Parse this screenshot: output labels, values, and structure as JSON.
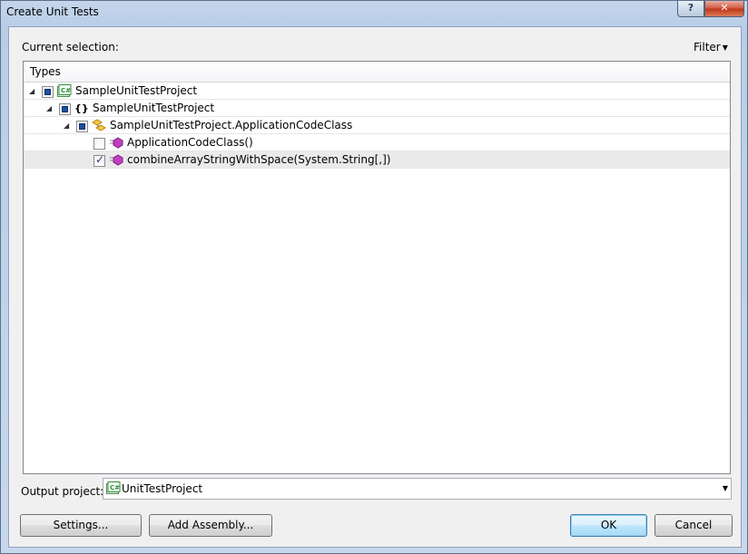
{
  "window": {
    "title": "Create Unit Tests",
    "help_label": "?",
    "close_label": "✕"
  },
  "current_selection_label": "Current selection:",
  "filter_label": "Filter",
  "tree": {
    "header": "Types",
    "rows": [
      {
        "label": "SampleUnitTestProject",
        "expander": "◢",
        "check": "partial",
        "icon": "csharp-project-icon"
      },
      {
        "label": "SampleUnitTestProject",
        "expander": "◢",
        "check": "partial",
        "icon": "namespace-icon",
        "glyph": "{}"
      },
      {
        "label": "SampleUnitTestProject.ApplicationCodeClass",
        "expander": "◢",
        "check": "partial",
        "icon": "class-icon"
      },
      {
        "label": "ApplicationCodeClass()",
        "expander": "",
        "check": "unchecked",
        "icon": "method-icon"
      },
      {
        "label": "combineArrayStringWithSpace(System.String[,])",
        "expander": "",
        "check": "checked",
        "icon": "method-icon",
        "selected": true
      }
    ]
  },
  "output_project": {
    "label": "Output project:",
    "value": "UnitTestProject"
  },
  "buttons": {
    "settings": "Settings...",
    "add_assembly": "Add Assembly...",
    "ok": "OK",
    "cancel": "Cancel"
  },
  "colors": {
    "check_fill": "#1e4f9c",
    "method_icon": "#c040c0",
    "csharp_icon": "#2e8b3a"
  }
}
